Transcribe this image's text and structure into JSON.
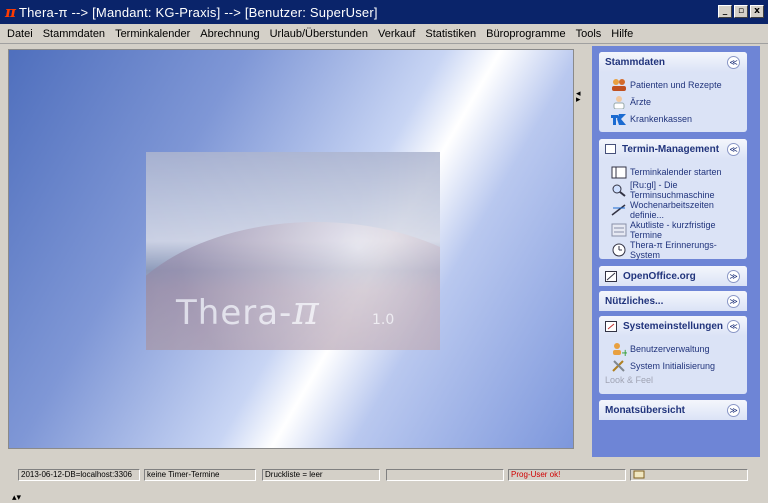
{
  "window": {
    "logo_glyph": "π",
    "title": "Thera-π --> [Mandant: KG-Praxis] --> [Benutzer: SuperUser]",
    "buttons": [
      "_",
      "▫",
      "x"
    ]
  },
  "menu": [
    "Datei",
    "Stammdaten",
    "Terminkalender",
    "Abrechnung",
    "Urlaub/Überstunden",
    "Verkauf",
    "Statistiken",
    "Büroprogramme",
    "Tools",
    "Hilfe"
  ],
  "splash": {
    "brand": "Thera-",
    "pi": "π",
    "version": "1.0"
  },
  "sidepanel": {
    "groups": [
      {
        "title": "Stammdaten",
        "chevron": "≪",
        "items": [
          {
            "label": "Patienten und Rezepte",
            "icon": "patients-icon"
          },
          {
            "label": "Ärzte",
            "icon": "doctor-icon"
          },
          {
            "label": "Krankenkassen",
            "icon": "insurance-icon"
          }
        ]
      },
      {
        "title": "Termin-Management",
        "chevron": "≪",
        "items": [
          {
            "label": "Terminkalender starten",
            "icon": "calendar-icon"
          },
          {
            "label": "[Ru:gl] - Die Terminsuchmaschine",
            "icon": "search-icon"
          },
          {
            "label": "Wochenarbeitszeiten definie...",
            "icon": "worktime-icon"
          },
          {
            "label": "Akutliste - kurzfristige Termine",
            "icon": "list-icon"
          },
          {
            "label": "Thera-π Erinnerungs-System",
            "icon": "clock-icon"
          }
        ]
      },
      {
        "title": "OpenOffice.org",
        "chevron": "≫"
      },
      {
        "title": "Nützliches...",
        "chevron": "≫"
      },
      {
        "title": "Systemeinstellungen",
        "chevron": "≪",
        "items": [
          {
            "label": "Benutzerverwaltung",
            "icon": "users-icon"
          },
          {
            "label": "System Initialisierung",
            "icon": "tools-icon"
          },
          {
            "label": "Look & Feel",
            "icon": "",
            "disabled": true
          }
        ]
      },
      {
        "title": "Monatsübersicht",
        "chevron": "≫"
      }
    ]
  },
  "statusbar": {
    "db": "2013-06-12-DB=localhost:3306",
    "timer": "keine Timer-Termine",
    "print": "Druckliste = leer",
    "empty": "",
    "prog_user": "Prog-User ok!",
    "last": ""
  },
  "colors": {
    "title_bg": "#0a246a",
    "panel_bg": "#6e85d6",
    "group_bg": "#dbe3f6",
    "link": "#21347c",
    "ok_red": "#d00000"
  }
}
